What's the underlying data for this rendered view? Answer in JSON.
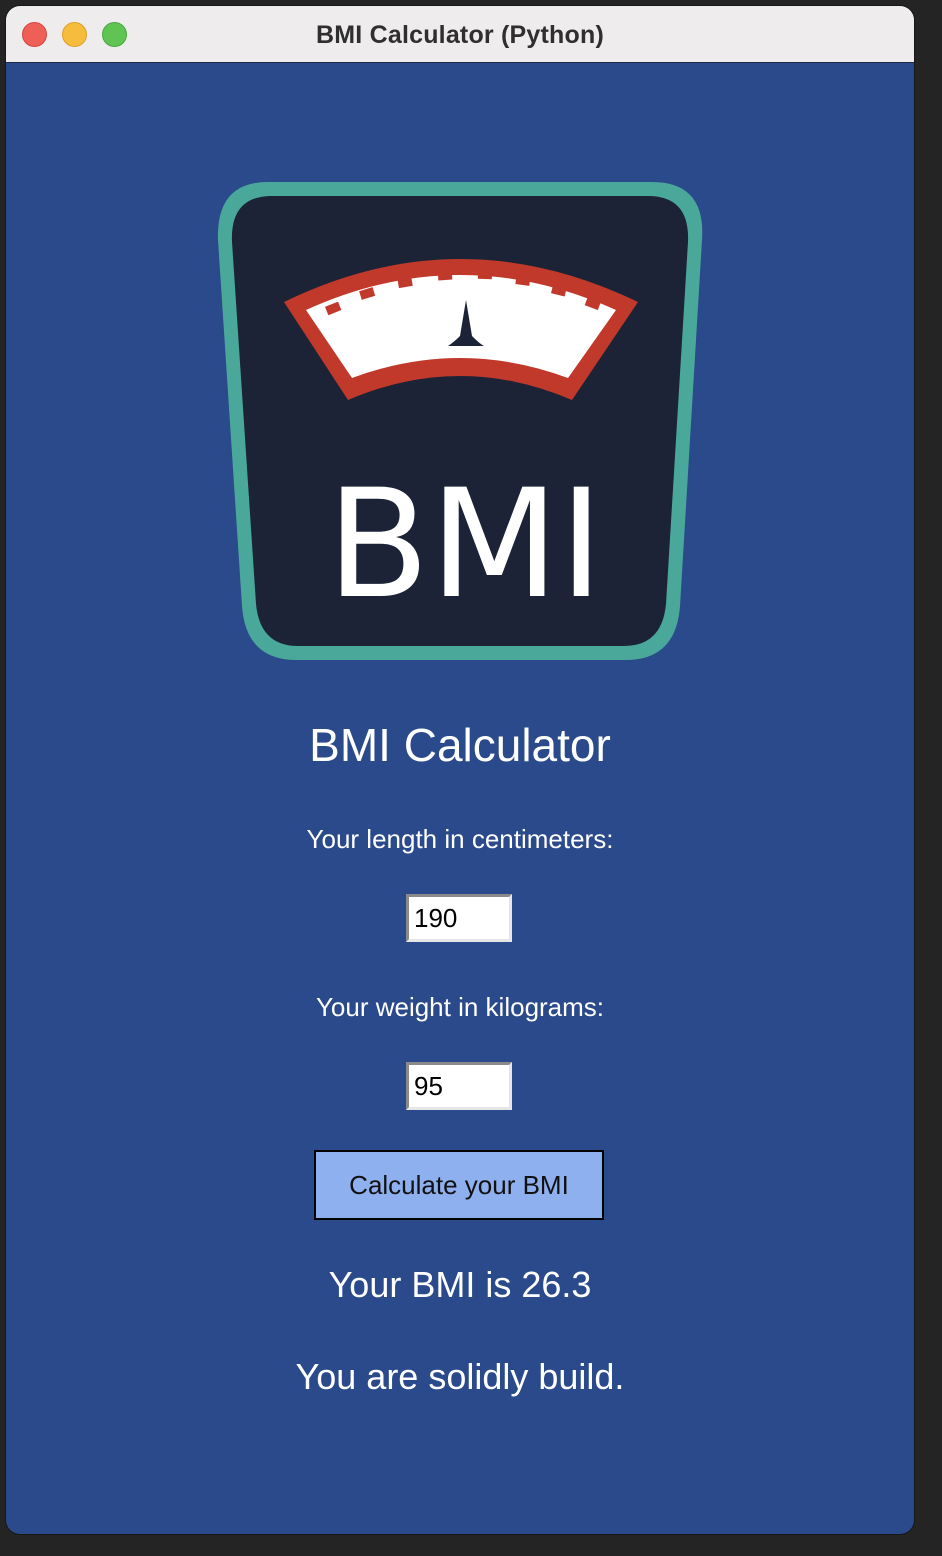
{
  "window": {
    "title": "BMI Calculator (Python)"
  },
  "logo": {
    "icon": "bmi-scale-logo",
    "text": "BMI"
  },
  "main": {
    "heading": "BMI Calculator",
    "length_label": "Your length in centimeters:",
    "length_value": "190",
    "weight_label": "Your weight in kilograms:",
    "weight_value": "95",
    "calculate_button": "Calculate your BMI",
    "result_text": "Your BMI is 26.3",
    "result_message": "You are solidly build."
  },
  "colors": {
    "background": "#2b4a8b",
    "button": "#8fb0ef",
    "logo_border": "#4aa89b",
    "logo_fill": "#1c2336",
    "gauge_arc": "#c0392b"
  }
}
